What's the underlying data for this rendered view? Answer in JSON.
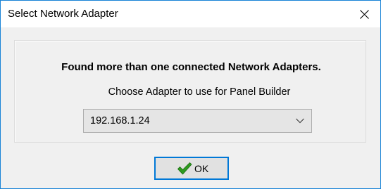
{
  "window": {
    "title": "Select Network Adapter",
    "border_color": "#1883d7",
    "close_icon": "close-icon"
  },
  "dialog": {
    "headline": "Found more than one connected Network Adapters.",
    "prompt": "Choose Adapter to use for Panel Builder",
    "adapter_select": {
      "selected_value": "192.168.1.24",
      "icon": "chevron-down-icon"
    }
  },
  "buttons": {
    "ok_label": "OK",
    "ok_icon": "checkmark-icon",
    "ok_icon_color": "#2e9a1f",
    "focus_color": "#0078d7"
  }
}
